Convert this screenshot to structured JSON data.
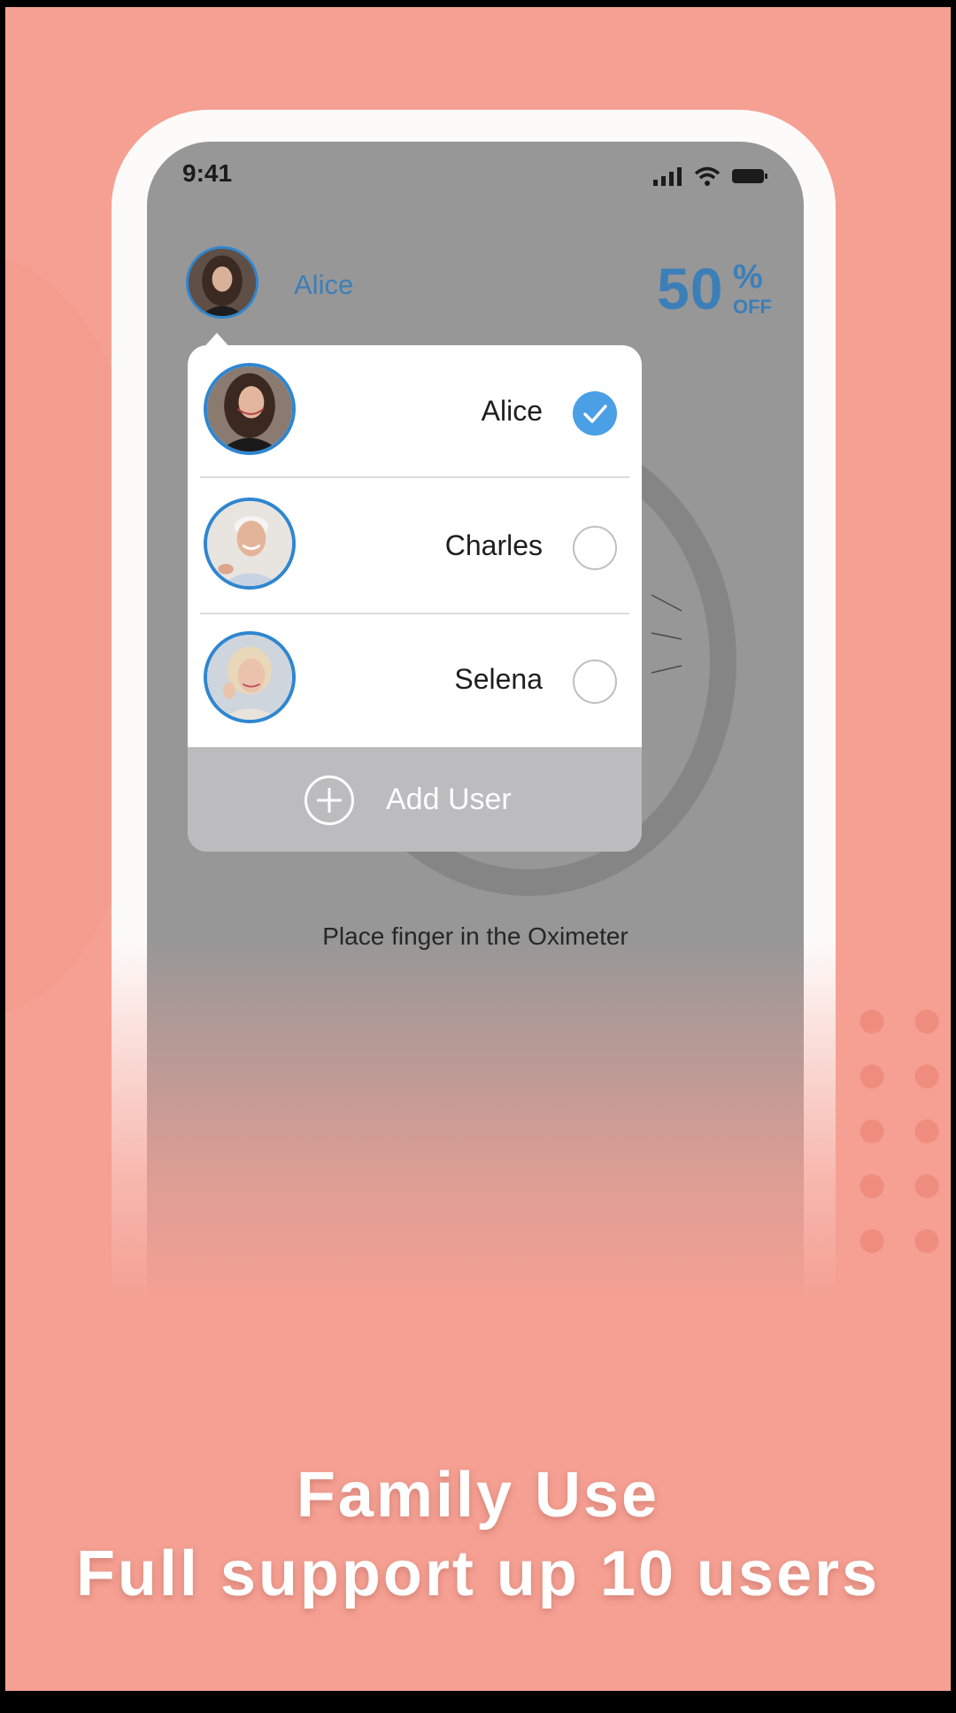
{
  "status_bar": {
    "time": "9:41"
  },
  "header": {
    "current_user": "Alice",
    "discount_number": "50",
    "discount_percent": "%",
    "discount_off": "OFF"
  },
  "user_menu": {
    "users": [
      {
        "name": "Alice",
        "selected": true
      },
      {
        "name": "Charles",
        "selected": false
      },
      {
        "name": "Selena",
        "selected": false
      }
    ],
    "add_user_label": "Add User"
  },
  "main": {
    "hint": "Place finger in the Oximeter"
  },
  "caption": {
    "line1": "Family Use",
    "line2": "Full support up 10 users"
  },
  "colors": {
    "background": "#f5a093",
    "screen": "#979797",
    "accent": "#2f86d0",
    "check": "#4a9fe5"
  }
}
